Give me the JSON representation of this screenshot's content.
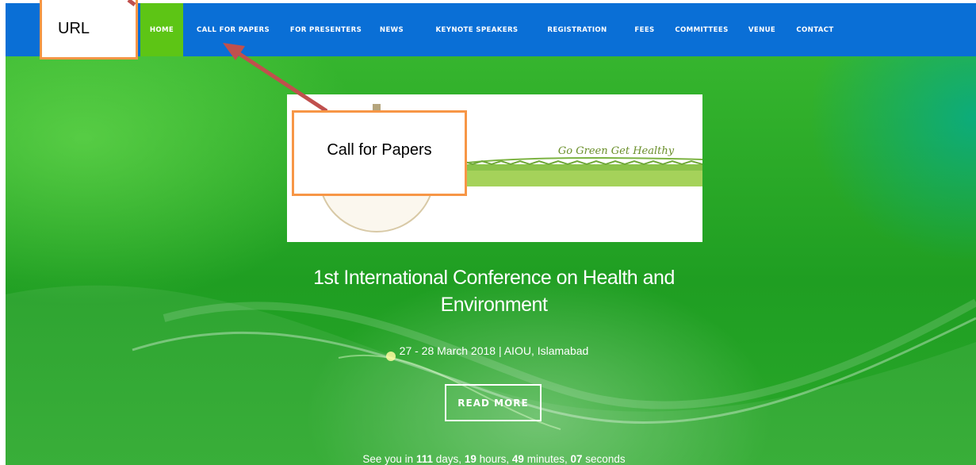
{
  "nav": {
    "items": [
      {
        "label": "HOME",
        "active": true
      },
      {
        "label": "CALL FOR PAPERS",
        "active": false
      },
      {
        "label": "FOR PRESENTERS",
        "active": false
      },
      {
        "label": "NEWS",
        "active": false
      },
      {
        "label": "KEYNOTE SPEAKERS",
        "active": false
      },
      {
        "label": "REGISTRATION",
        "active": false
      },
      {
        "label": "FEES",
        "active": false
      },
      {
        "label": "COMMITTEES",
        "active": false
      },
      {
        "label": "VENUE",
        "active": false
      },
      {
        "label": "CONTACT",
        "active": false
      }
    ]
  },
  "banner": {
    "tagline": "Go Green Get Healthy"
  },
  "hero": {
    "title_line1": "1st International Conference on Health and",
    "title_line2": "Environment",
    "date_venue": "27 - 28 March 2018 | AIOU, Islamabad",
    "read_more_label": "READ MORE"
  },
  "countdown": {
    "prefix": "See you in",
    "days": "111",
    "days_label": "days,",
    "hours": "19",
    "hours_label": "hours,",
    "minutes": "49",
    "minutes_label": "minutes,",
    "seconds": "07",
    "seconds_label": "seconds"
  },
  "annotations": {
    "url_label": "URL",
    "cfp_label": "Call for Papers"
  },
  "colors": {
    "navbar": "#0a6fd6",
    "active_tab": "#5dc515",
    "callout_border": "#f79646",
    "arrow": "#c0504d"
  }
}
